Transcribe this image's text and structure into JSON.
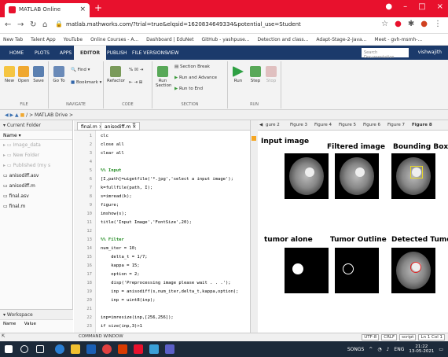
{
  "browser": {
    "tab_title": "MATLAB Online",
    "url": "matlab.mathworks.com/?trial=true&elqsid=1620834649334&potential_use=Student",
    "bookmarks": [
      "New Tab",
      "Talent App",
      "YouTube",
      "Online Courses - A...",
      "Dashboard | EduNet",
      "GitHub - yashpuse...",
      "Detection and class...",
      "Adapt-Stage-2-Java...",
      "Meet - gvh-msmh-..."
    ],
    "profile": "vishwajith"
  },
  "matlab": {
    "tabs": [
      "HOME",
      "PLOTS",
      "APPS",
      "EDITOR",
      "PUBLISH",
      "FILE VERSIONS",
      "VIEW"
    ],
    "active_tab": "EDITOR",
    "search_placeholder": "Search Documentation",
    "ribbon": {
      "file": [
        "New",
        "Open",
        "Save"
      ],
      "navigate": [
        "Go To",
        "Find",
        "Bookmark"
      ],
      "code": [
        "Refactor"
      ],
      "section": [
        "Section Break",
        "Run and Advance",
        "Run Section",
        "Run to End"
      ],
      "run": [
        "Run",
        "Step",
        "Stop"
      ],
      "group_labels": [
        "FILE",
        "NAVIGATE",
        "CODE",
        "SECTION",
        "RUN"
      ]
    },
    "path": "/ > MATLAB Drive >",
    "current_folder": {
      "title": "Current Folder",
      "header": "Name",
      "items": [
        {
          "name": "Image_data",
          "dim": true
        },
        {
          "name": "New Folder",
          "dim": true
        },
        {
          "name": "Published (my s",
          "dim": true
        },
        {
          "name": "anisodiff.asv",
          "dim": false
        },
        {
          "name": "anisodiff.m",
          "dim": false
        },
        {
          "name": "final.asv",
          "dim": false
        },
        {
          "name": "final.m",
          "dim": false
        }
      ]
    },
    "workspace": {
      "title": "Workspace",
      "cols": [
        "Name",
        "Value"
      ]
    },
    "editor_tabs": [
      "final.m",
      "anisodiff.m"
    ],
    "code_lines": [
      {
        "n": "1",
        "text": "clc",
        "cls": ""
      },
      {
        "n": "2",
        "text": "close all",
        "cls": ""
      },
      {
        "n": "3",
        "text": "clear all",
        "cls": ""
      },
      {
        "n": "4",
        "text": "",
        "cls": ""
      },
      {
        "n": "5",
        "text": "%% Input",
        "cls": "sec"
      },
      {
        "n": "6",
        "text": "[I,path]=uigetfile('*.jpg','select a input image');",
        "cls": ""
      },
      {
        "n": "7",
        "text": "k=fullfile(path, I);",
        "cls": ""
      },
      {
        "n": "8",
        "text": "s=imread(k);",
        "cls": ""
      },
      {
        "n": "9",
        "text": "figure;",
        "cls": ""
      },
      {
        "n": "10",
        "text": "imshow(s);",
        "cls": ""
      },
      {
        "n": "11",
        "text": "title('Input Image','FontSize',20);",
        "cls": ""
      },
      {
        "n": "12",
        "text": "",
        "cls": ""
      },
      {
        "n": "13",
        "text": "%% Filter",
        "cls": "sec"
      },
      {
        "n": "14",
        "text": "num_iter = 10;",
        "cls": ""
      },
      {
        "n": "15",
        "text": "    delta_t = 1/7;",
        "cls": ""
      },
      {
        "n": "16",
        "text": "    kappa = 15;",
        "cls": ""
      },
      {
        "n": "17",
        "text": "    option = 2;",
        "cls": ""
      },
      {
        "n": "18",
        "text": "    disp('Preprocessing image please wait . . .');",
        "cls": ""
      },
      {
        "n": "19",
        "text": "    inp = anisodiff(s,num_iter,delta_t,kappa,option);",
        "cls": ""
      },
      {
        "n": "20",
        "text": "    inp = uint8(inp);",
        "cls": ""
      },
      {
        "n": "21",
        "text": "",
        "cls": ""
      },
      {
        "n": "22",
        "text": "inp=imresize(inp,[256,256]);",
        "cls": ""
      },
      {
        "n": "23",
        "text": "if size(inp,3)>1",
        "cls": ""
      }
    ],
    "figure_tabs": [
      "gure 2",
      "Figure 3",
      "Figure 4",
      "Figure 5",
      "Figure 6",
      "Figure 7",
      "Figure 8"
    ],
    "subplot_titles": [
      "Input image",
      "Filtered image",
      "Bounding Box",
      "tumor alone",
      "Tumor Outline",
      "Detected Tumor"
    ],
    "command_window": "COMMAND WINDOW",
    "status": [
      "UTF-8",
      "CRLF",
      "script",
      "Ln 1 Col 1"
    ]
  },
  "taskbar": {
    "tray_text": "SONGS",
    "lang": "ENG",
    "time": "21:22",
    "date": "13-05-2021"
  }
}
